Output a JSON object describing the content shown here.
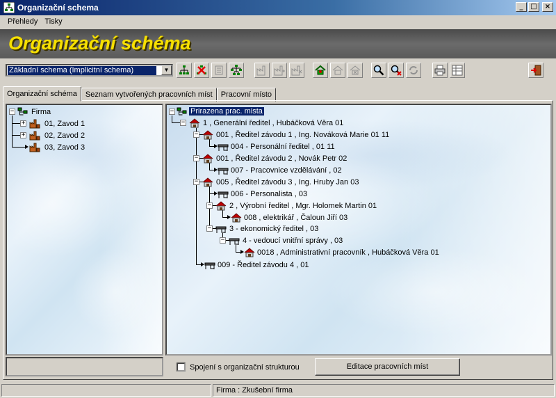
{
  "window": {
    "title": "Organizační schema",
    "controls": {
      "minimize": "_",
      "maximize": "□",
      "close": "×"
    }
  },
  "menu": [
    {
      "label": "Přehledy"
    },
    {
      "label": "Tisky"
    }
  ],
  "banner": {
    "title": "Organizační schéma"
  },
  "toolbar": {
    "schema_selected": "Základní schema  (Implicitní schema)",
    "buttons": [
      "org-tree-icon",
      "delete-red-x-icon",
      "building-doc-icon",
      "org-chart-icon",
      "factory-icon",
      "factory-add-icon",
      "factory-delete-icon",
      "house-green-icon",
      "house-add-icon",
      "house-delete-icon",
      "magnifier-icon",
      "magnifier-x-icon",
      "refresh-icon",
      "print-icon",
      "table-icon",
      "exit-door-icon"
    ]
  },
  "tabs": [
    {
      "label": "Organizační schéma",
      "active": true
    },
    {
      "label": "Seznam vytvořených pracovních míst",
      "active": false
    },
    {
      "label": "Pracovní místo",
      "active": false
    }
  ],
  "left_tree": {
    "root": {
      "label": "Firma",
      "expander": "−"
    },
    "items": [
      {
        "label": "01,  Zavod 1",
        "expander": "+"
      },
      {
        "label": "02,  Zavod 2",
        "expander": "+"
      },
      {
        "label": "03,  Zavod 3",
        "expander": ""
      }
    ]
  },
  "right_tree": {
    "root": {
      "label": "Prirazena prac. mista",
      "expander": "−"
    },
    "items": [
      {
        "label": "1 , Generální ředitel ,  Hubáčková Věra 01",
        "expander": "−",
        "icon": "house"
      },
      {
        "label": "001 , Ředitel závodu 1 , Ing. Nováková Marie 01  11",
        "expander": "−",
        "icon": "house"
      },
      {
        "label": "004 - Personální ředitel  , 01  11",
        "expander": "",
        "icon": "desk"
      },
      {
        "label": "001 , Ředitel závodu 2 ,  Novák Petr 02",
        "expander": "−",
        "icon": "house"
      },
      {
        "label": "007 - Pracovnice vzdělávání  , 02",
        "expander": "",
        "icon": "desk"
      },
      {
        "label": "005 , Ředitel závodu 3 , Ing. Hruby Jan 03",
        "expander": "−",
        "icon": "house"
      },
      {
        "label": "006 - Personalista  , 03",
        "expander": "",
        "icon": "desk"
      },
      {
        "label": "2 , Výrobní ředitel , Mgr. Holomek Martin 01",
        "expander": "−",
        "icon": "house"
      },
      {
        "label": "008 , elektrikář ,  Čaloun Jiří 03",
        "expander": "",
        "icon": "house"
      },
      {
        "label": "3 - ekonomický ředitel  , 03",
        "expander": "−",
        "icon": "desk"
      },
      {
        "label": "4 - vedoucí vnitřní správy  , 03",
        "expander": "−",
        "icon": "desk"
      },
      {
        "label": "0018 , Administrativní pracovník ,  Hubáčková Věra 01",
        "expander": "",
        "icon": "house"
      },
      {
        "label": "009 - Ředitel závodu 4  , 01",
        "expander": "",
        "icon": "desk"
      }
    ]
  },
  "bottom": {
    "checkbox_label": "Spojení s organizační strukturou",
    "checkbox_checked": false,
    "edit_button": "Editace pracovních míst"
  },
  "status": {
    "firm": "Firma :  Zkušební firma"
  }
}
